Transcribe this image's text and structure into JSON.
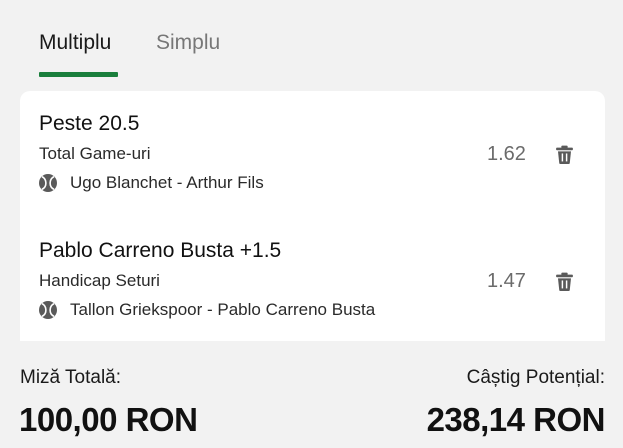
{
  "tabs": [
    {
      "label": "Multiplu",
      "active": true
    },
    {
      "label": "Simplu",
      "active": false
    }
  ],
  "colors": {
    "accent": "#1a7f3c",
    "background": "#f2f2f2",
    "card": "#ffffff",
    "odds_text": "#6b6b6b"
  },
  "selections": [
    {
      "title": "Peste 20.5",
      "market": "Total Game-uri",
      "event": "Ugo Blanchet - Arthur Fils",
      "odds": "1.62",
      "sport_icon": "tennis-ball-icon",
      "remove_icon": "trash-icon"
    },
    {
      "title": "Pablo Carreno Busta +1.5",
      "market": "Handicap Seturi",
      "event": "Tallon Griekspoor - Pablo Carreno Busta",
      "odds": "1.47",
      "sport_icon": "tennis-ball-icon",
      "remove_icon": "trash-icon"
    }
  ],
  "totals": {
    "stake_label": "Miză Totală:",
    "stake_value": "100,00 RON",
    "win_label": "Câștig Potențial:",
    "win_value": "238,14 RON"
  }
}
